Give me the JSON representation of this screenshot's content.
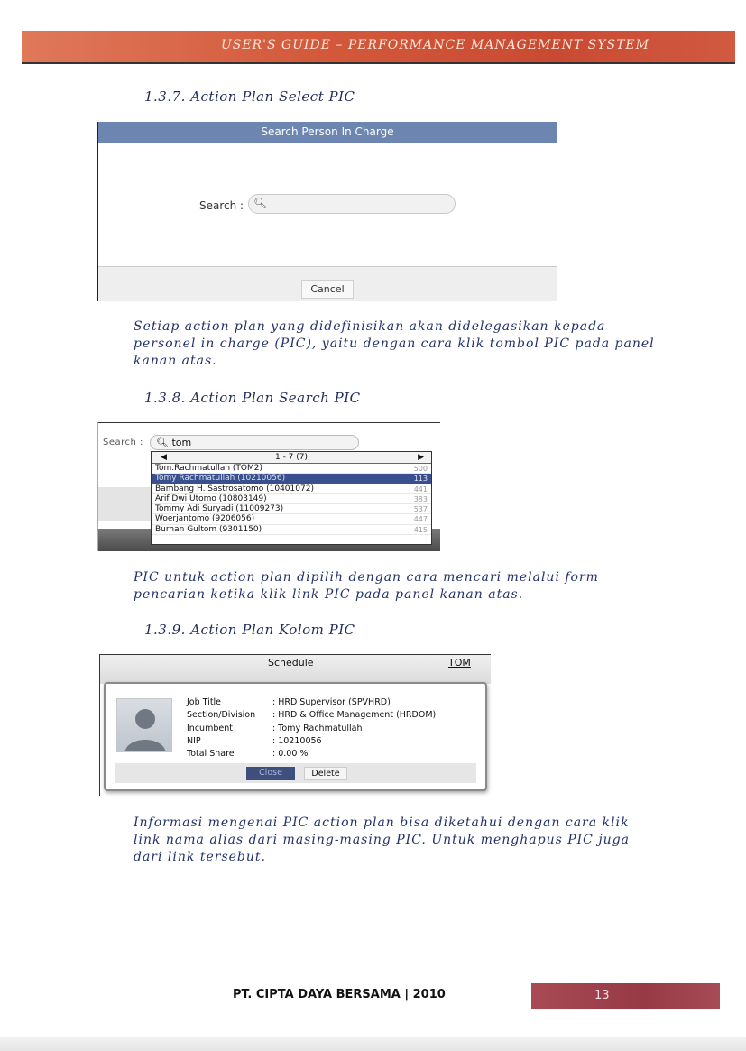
{
  "header": {
    "title": "USER'S GUIDE – PERFORMANCE MANAGEMENT SYSTEM"
  },
  "sections": [
    {
      "heading": "1.3.7.  Action Plan Select PIC",
      "paragraph_lines": [
        "Setiap action plan yang didefinisikan akan didelegasikan kepada",
        "personel in charge (PIC), yaitu dengan cara klik tombol PIC pada panel",
        "kanan atas."
      ]
    },
    {
      "heading": "1.3.8.  Action Plan Search PIC",
      "paragraph_lines": [
        "PIC untuk action plan dipilih dengan cara mencari melalui form",
        "pencarian ketika klik link PIC pada panel kanan atas."
      ]
    },
    {
      "heading": "1.3.9.  Action Plan Kolom PIC",
      "paragraph_lines": [
        "Informasi mengenai PIC action plan bisa diketahui dengan cara klik",
        "link nama alias dari masing-masing PIC. Untuk menghapus PIC juga",
        "dari link tersebut."
      ]
    }
  ],
  "figure1": {
    "title": "Search Person In Charge",
    "search_label": "Search :",
    "search_icon": "magnifier-icon",
    "cancel_label": "Cancel"
  },
  "figure2": {
    "search_label": "Search :",
    "search_value": "tom",
    "pager": {
      "prev": "◀",
      "range": "1 - 7 (7)",
      "next": "▶"
    },
    "rows": [
      {
        "name": "Tom.Rachmatullah (TOM2)",
        "num": "500",
        "selected": false
      },
      {
        "name": "Tomy Rachmatullah (10210056)",
        "num": "113",
        "selected": true
      },
      {
        "name": "Bambang H. Sastrosatomo (10401072)",
        "num": "441",
        "selected": false
      },
      {
        "name": "Arif Dwi Utomo (10803149)",
        "num": "383",
        "selected": false
      },
      {
        "name": "Tommy Adi Suryadi (11009273)",
        "num": "537",
        "selected": false
      },
      {
        "name": "Woerjantomo (9206056)",
        "num": "447",
        "selected": false
      },
      {
        "name": "Burhan Gultom (9301150)",
        "num": "415",
        "selected": false
      }
    ]
  },
  "figure3": {
    "column_header": "Schedule",
    "alias_link": "TOM",
    "avatar_icon": "person-avatar-icon",
    "fields": [
      {
        "key": "Job Title",
        "value": ": HRD Supervisor (SPVHRD)"
      },
      {
        "key": "Section/Division",
        "value": ": HRD & Office Management (HRDOM)"
      },
      {
        "key": "Incumbent",
        "value": ": Tomy Rachmatullah"
      },
      {
        "key": "NIP",
        "value": ": 10210056"
      },
      {
        "key": "Total Share",
        "value": ": 0.00 %"
      }
    ],
    "close_label": "Close",
    "delete_label": "Delete"
  },
  "footer": {
    "company": "PT. CIPTA DAYA BERSAMA | 2010",
    "page_number": "13"
  }
}
